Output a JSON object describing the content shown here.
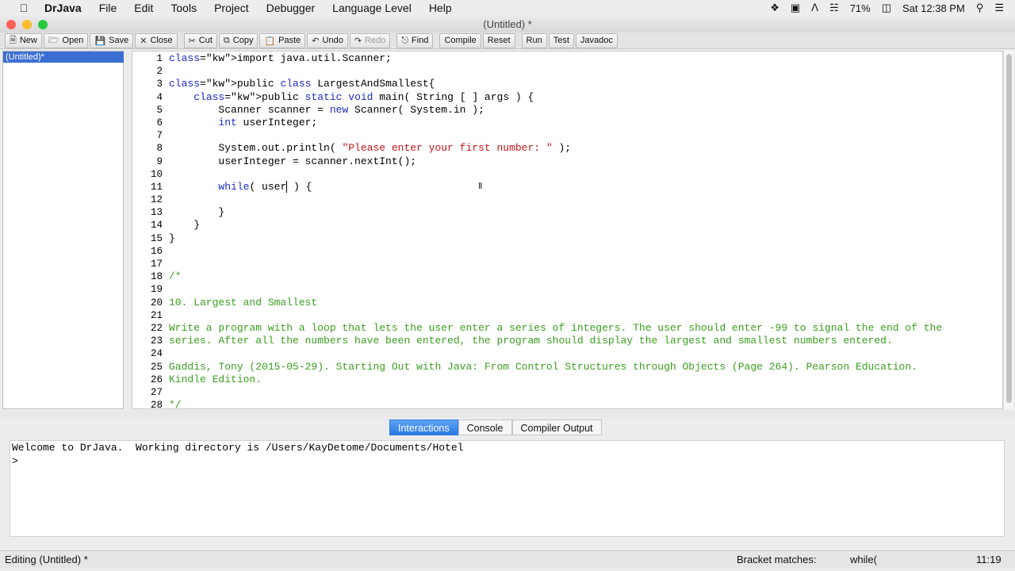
{
  "menubar": {
    "app_name": "DrJava",
    "items": [
      "File",
      "Edit",
      "Tools",
      "Project",
      "Debugger",
      "Language Level",
      "Help"
    ],
    "battery": "71%",
    "clock": "Sat 12:38 PM"
  },
  "window": {
    "title": "(Untitled) *"
  },
  "toolbar": {
    "new": "New",
    "open": "Open",
    "save": "Save",
    "close": "Close",
    "cut": "Cut",
    "copy": "Copy",
    "paste": "Paste",
    "undo": "Undo",
    "redo": "Redo",
    "find": "Find",
    "compile": "Compile",
    "reset": "Reset",
    "run": "Run",
    "test": "Test",
    "javadoc": "Javadoc"
  },
  "doclist": {
    "items": [
      "(Untitled)*"
    ]
  },
  "editor": {
    "line_numbers": [
      "1",
      "2",
      "3",
      "4",
      "5",
      "6",
      "7",
      "8",
      "9",
      "10",
      "11",
      "12",
      "13",
      "14",
      "15",
      "16",
      "17",
      "18",
      "19",
      "20",
      "21",
      "22",
      "23",
      "24",
      "25",
      "26",
      "27",
      "28"
    ],
    "lines": [
      "import java.util.Scanner;",
      "",
      "public class LargestAndSmallest{",
      "    public static void main( String [ ] args ) {",
      "        Scanner scanner = new Scanner( System.in );",
      "        int userInteger;",
      "",
      "        System.out.println( \"Please enter your first number: \" );",
      "        userInteger = scanner.nextInt();",
      "",
      "        while( user ) {",
      "",
      "        }",
      "    }",
      "}",
      "",
      "",
      "/*",
      "",
      "10. Largest and Smallest",
      "",
      "Write a program with a loop that lets the user enter a series of integers. The user should enter -99 to signal the end of the",
      "series. After all the numbers have been entered, the program should display the largest and smallest numbers entered.",
      "",
      "Gaddis, Tony (2015-05-29). Starting Out with Java: From Control Structures through Objects (Page 264). Pearson Education.",
      "Kindle Edition.",
      "",
      "*/"
    ]
  },
  "tabs": [
    "Interactions",
    "Console",
    "Compiler Output"
  ],
  "interactions": {
    "welcome": "Welcome to DrJava.  Working directory is /Users/KayDetome/Documents/Hotel",
    "prompt": ">"
  },
  "status": {
    "editing": "Editing (Untitled) *",
    "bracket_label": "Bracket matches:",
    "bracket_value": "while(",
    "position": "11:19"
  },
  "colors": {
    "keyword": "#1c2ac8",
    "string": "#c8141a",
    "comment": "#3a9f1e",
    "selection": "#3b6fd4",
    "active_tab": "#2b7be3"
  }
}
